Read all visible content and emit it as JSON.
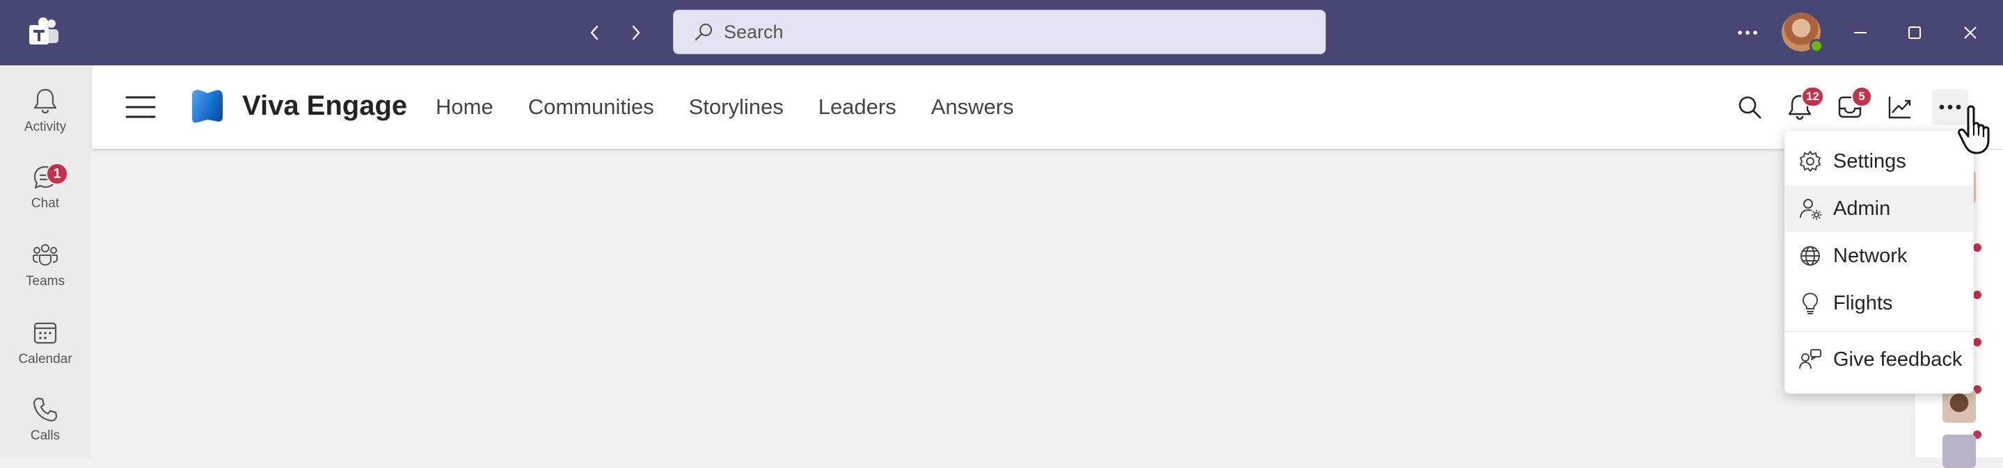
{
  "titlebar": {
    "search_placeholder": "Search"
  },
  "rail": {
    "items": [
      {
        "label": "Activity",
        "icon": "bell-icon"
      },
      {
        "label": "Chat",
        "icon": "chat-icon",
        "badge": "1"
      },
      {
        "label": "Teams",
        "icon": "teams-icon"
      },
      {
        "label": "Calendar",
        "icon": "calendar-icon"
      },
      {
        "label": "Calls",
        "icon": "phone-icon"
      }
    ]
  },
  "header": {
    "app_title": "Viva Engage",
    "nav": [
      "Home",
      "Communities",
      "Storylines",
      "Leaders",
      "Answers"
    ],
    "notifications_badge": "12",
    "inbox_badge": "5"
  },
  "menu": {
    "items": [
      {
        "label": "Settings",
        "icon": "gear-icon"
      },
      {
        "label": "Admin",
        "icon": "admin-icon"
      },
      {
        "label": "Network",
        "icon": "globe-icon"
      },
      {
        "label": "Flights",
        "icon": "lightbulb-icon"
      },
      {
        "label": "Give feedback",
        "icon": "feedback-icon"
      }
    ]
  },
  "colors": {
    "titlebar": "#464775",
    "badge": "#c4314b",
    "status_available": "#6bb700"
  }
}
